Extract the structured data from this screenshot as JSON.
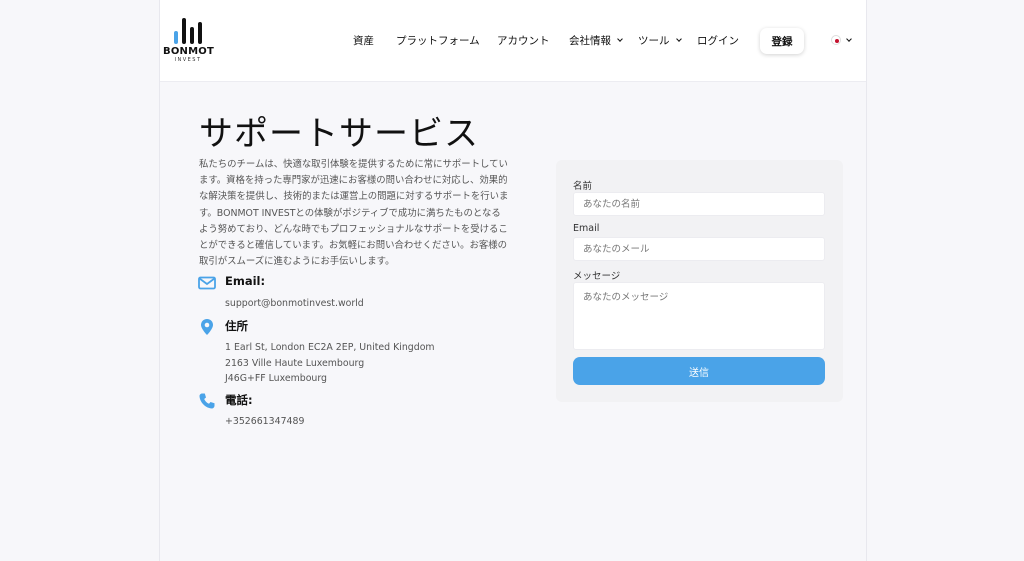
{
  "brand": {
    "name": "BONMOT",
    "sub": "INVEST",
    "colors": {
      "accent": "#4aa3e8",
      "dark": "#111111"
    }
  },
  "nav": {
    "items": [
      {
        "label": "資産"
      },
      {
        "label": "プラットフォーム"
      },
      {
        "label": "アカウント"
      },
      {
        "label": "会社情報",
        "dropdown": true
      },
      {
        "label": "ツール",
        "dropdown": true
      },
      {
        "label": "ログイン"
      }
    ],
    "register": "登録",
    "language_icon": "japan-flag-icon"
  },
  "page": {
    "title": "サポートサービス",
    "intro": "私たちのチームは、快適な取引体験を提供するために常にサポートしています。資格を持った専門家が迅速にお客様の問い合わせに対応し、効果的な解決策を提供し、技術的または運営上の問題に対するサポートを行います。BONMOT INVESTとの体験がポジティブで成功に満ちたものとなるよう努めており、どんな時でもプロフェッショナルなサポートを受けることができると確信しています。お気軽にお問い合わせください。お客様の取引がスムーズに進むようにお手伝いします。"
  },
  "contact": {
    "email": {
      "label": "Email:",
      "value": "support@bonmotinvest.world",
      "icon": "envelope-icon"
    },
    "address": {
      "label": "住所",
      "lines": [
        "1 Earl St, London EC2A 2EP, United Kingdom",
        "2163 Ville Haute Luxembourg",
        "J46G+FF Luxembourg"
      ],
      "icon": "location-pin-icon"
    },
    "phone": {
      "label": "電話:",
      "value": "+352661347489",
      "icon": "phone-icon"
    }
  },
  "form": {
    "name_label": "名前",
    "name_placeholder": "あなたの名前",
    "email_label": "Email",
    "email_placeholder": "あなたのメール",
    "message_label": "メッセージ",
    "message_placeholder": "あなたのメッセージ",
    "submit": "送信"
  }
}
